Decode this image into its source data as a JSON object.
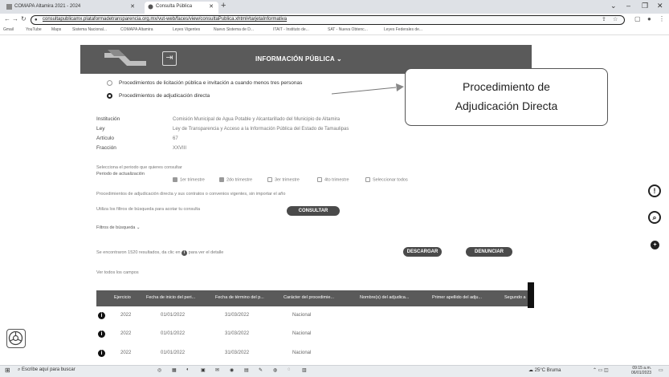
{
  "browser": {
    "tabs": [
      {
        "label": "COMAPA Altamira 2021 - 2024"
      },
      {
        "label": "Consulta Pública"
      }
    ],
    "url": "consultapublicamx.plataformadetransparencia.org.mx/vut-web/faces/view/consultaPublica.xhtml#tarjetaInformativa",
    "bookmarks": [
      "Gmail",
      "YouTube",
      "Maps",
      "Sistema Nacional...",
      "COMAPA Altamira",
      "Leyes Vigentes",
      "Nuevo Sistema de D...",
      "ITAIT - Instituto de...",
      "SAT - Nueva Obtenc...",
      "Leyes Federales de..."
    ]
  },
  "site": {
    "title": "INFORMACIÓN PÚBLICA",
    "chevron": "⌄"
  },
  "procedures": [
    {
      "label": "Procedimientos de licitación pública e invitación a cuando menos tres personas",
      "selected": false
    },
    {
      "label": "Procedimientos de adjudicación directa",
      "selected": true
    }
  ],
  "callout": {
    "line1": "Procedimiento de",
    "line2": "Adjudicación Directa"
  },
  "info": [
    {
      "label": "Institución",
      "value": "Comisión Municipal de Agua Potable y Alcantarillado del Municipio de Altamira"
    },
    {
      "label": "Ley",
      "value": "Ley de Transparencia y Acceso a la Información Pública del Estado de Tamaulipas"
    },
    {
      "label": "Artículo",
      "value": "67"
    },
    {
      "label": "Fracción",
      "value": "XXVIII"
    }
  ],
  "period": {
    "instruction": "Selecciona el periodo que quieres consultar",
    "label": "Periodo de actualización",
    "options": [
      {
        "label": "1er trimestre",
        "checked": true
      },
      {
        "label": "2do trimestre",
        "checked": true
      },
      {
        "label": "3er trimestre",
        "checked": false
      },
      {
        "label": "4to trimestre",
        "checked": false
      },
      {
        "label": "Seleccionar todos",
        "checked": false
      }
    ]
  },
  "description": "Procedimientos de adjudicación directa y sus contratos o convenios vigentes, sin importar el año",
  "search_hint": "Utiliza los filtros de búsqueda para acotar tu consulta",
  "buttons": {
    "consultar": "CONSULTAR",
    "descargar": "DESCARGAR",
    "denunciar": "DENUNCIAR"
  },
  "filters_label": "Filtros de búsqueda ⌄",
  "results": {
    "text": "Se encontraron 1520 resultados, da clic en",
    "info_symbol": "i",
    "text_after": "para ver el detalle",
    "see_all": "Ver todos los campos"
  },
  "table": {
    "headers": [
      "Ejercicio",
      "Fecha de inicio del peri...",
      "Fecha de término del p...",
      "Carácter del procedimie...",
      "Nombre(s) del adjudica...",
      "Primer apellido del adju...",
      "Segundo a"
    ],
    "rows": [
      [
        "2022",
        "01/01/2022",
        "31/03/2022",
        "Nacional"
      ],
      [
        "2022",
        "01/01/2022",
        "31/03/2022",
        "Nacional"
      ],
      [
        "2022",
        "01/01/2022",
        "31/03/2022",
        "Nacional"
      ]
    ]
  },
  "taskbar": {
    "search": "Escribe aquí para buscar",
    "weather": "25°C Bruma",
    "time": "09:15 a.m.",
    "date": "06/01/2023"
  }
}
